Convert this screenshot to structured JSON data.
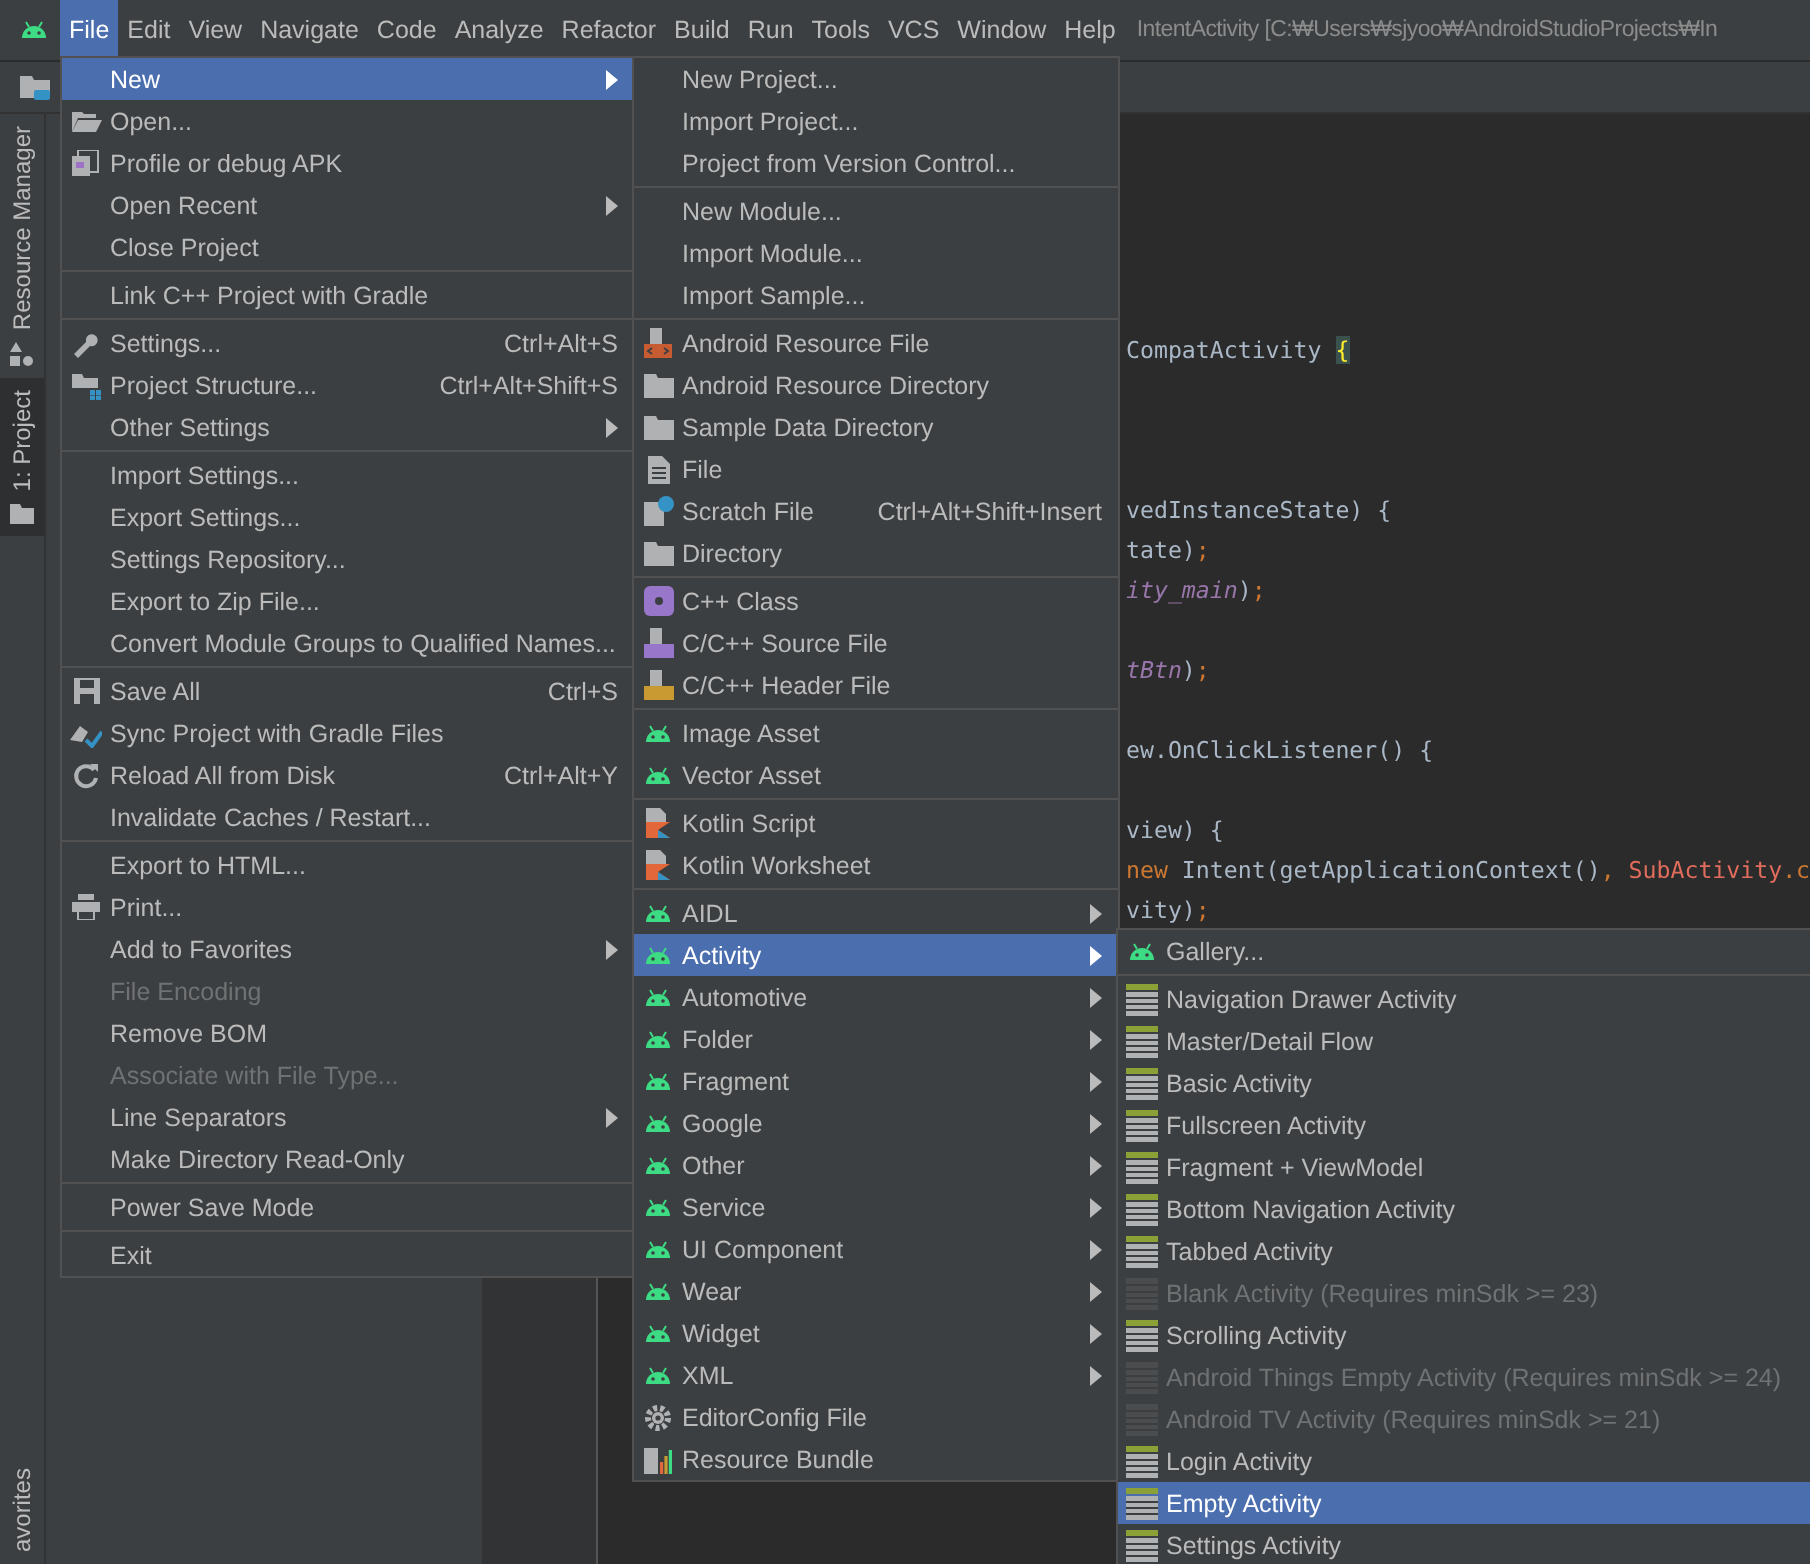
{
  "menu_bar": {
    "items": [
      {
        "label": "File",
        "selected": true
      },
      {
        "label": "Edit",
        "selected": false
      },
      {
        "label": "View",
        "selected": false
      },
      {
        "label": "Navigate",
        "selected": false
      },
      {
        "label": "Code",
        "selected": false
      },
      {
        "label": "Analyze",
        "selected": false
      },
      {
        "label": "Refactor",
        "selected": false
      },
      {
        "label": "Build",
        "selected": false
      },
      {
        "label": "Run",
        "selected": false
      },
      {
        "label": "Tools",
        "selected": false
      },
      {
        "label": "VCS",
        "selected": false
      },
      {
        "label": "Window",
        "selected": false
      },
      {
        "label": "Help",
        "selected": false
      }
    ],
    "title": "IntentActivity [C:₩Users₩sjyoo₩AndroidStudioProjects₩In"
  },
  "side_tabs": [
    {
      "label": "Resource Manager",
      "selected": false
    },
    {
      "label": "1: Project",
      "selected": true
    }
  ],
  "bottom_side_tab": {
    "label": "avorites"
  },
  "editor": {
    "lines": [
      {
        "spans": [
          {
            "text": "CompatActivity ",
            "kind": "plain"
          },
          {
            "text": "{",
            "kind": "brace-match"
          }
        ]
      },
      {
        "kind": "blank"
      },
      {
        "kind": "blank"
      },
      {
        "kind": "blank"
      },
      {
        "spans": [
          {
            "text": "vedInstanceState) {",
            "kind": "plain"
          }
        ]
      },
      {
        "spans": [
          {
            "text": "tate)",
            "kind": "plain"
          },
          {
            "text": ";",
            "kind": "keyword"
          }
        ]
      },
      {
        "spans": [
          {
            "text": "ity_main",
            "kind": "field"
          },
          {
            "text": ")",
            "kind": "plain"
          },
          {
            "text": ";",
            "kind": "keyword"
          }
        ]
      },
      {
        "kind": "blank"
      },
      {
        "spans": [
          {
            "text": "tBtn",
            "kind": "field"
          },
          {
            "text": ")",
            "kind": "plain"
          },
          {
            "text": ";",
            "kind": "keyword"
          }
        ]
      },
      {
        "kind": "blank"
      },
      {
        "spans": [
          {
            "text": "ew.OnClickListener() {",
            "kind": "plain"
          }
        ]
      },
      {
        "kind": "blank"
      },
      {
        "spans": [
          {
            "text": "view) {",
            "kind": "plain"
          }
        ]
      },
      {
        "spans": [
          {
            "text": "new ",
            "kind": "keyword"
          },
          {
            "text": "Intent(getApplicationContext()",
            "kind": "plain"
          },
          {
            "text": ", ",
            "kind": "keyword"
          },
          {
            "text": "SubActivity",
            "kind": "error"
          },
          {
            "text": ".c",
            "kind": "keyword"
          }
        ]
      },
      {
        "spans": [
          {
            "text": "vity)",
            "kind": "plain"
          },
          {
            "text": ";",
            "kind": "keyword"
          }
        ]
      }
    ]
  },
  "file_menu": {
    "groups": [
      {
        "items": [
          {
            "label": "New",
            "selected": true,
            "disabled": false,
            "submenu": true
          },
          {
            "label": "Open...",
            "selected": false,
            "disabled": false
          },
          {
            "label": "Profile or debug APK",
            "selected": false,
            "disabled": false
          },
          {
            "label": "Open Recent",
            "selected": false,
            "disabled": false,
            "submenu": true
          },
          {
            "label": "Close Project",
            "selected": false,
            "disabled": false
          }
        ]
      },
      {
        "items": [
          {
            "label": "Link C++ Project with Gradle",
            "selected": false,
            "disabled": false
          }
        ]
      },
      {
        "items": [
          {
            "label": "Settings...",
            "shortcut": "Ctrl+Alt+S",
            "selected": false,
            "disabled": false
          },
          {
            "label": "Project Structure...",
            "shortcut": "Ctrl+Alt+Shift+S",
            "selected": false,
            "disabled": false
          },
          {
            "label": "Other Settings",
            "selected": false,
            "disabled": false,
            "submenu": true
          }
        ]
      },
      {
        "items": [
          {
            "label": "Import Settings...",
            "selected": false,
            "disabled": false
          },
          {
            "label": "Export Settings...",
            "selected": false,
            "disabled": false
          },
          {
            "label": "Settings Repository...",
            "selected": false,
            "disabled": false
          },
          {
            "label": "Export to Zip File...",
            "selected": false,
            "disabled": false
          },
          {
            "label": "Convert Module Groups to Qualified Names...",
            "selected": false,
            "disabled": false
          }
        ]
      },
      {
        "items": [
          {
            "label": "Save All",
            "shortcut": "Ctrl+S",
            "selected": false,
            "disabled": false
          },
          {
            "label": "Sync Project with Gradle Files",
            "selected": false,
            "disabled": false
          },
          {
            "label": "Reload All from Disk",
            "shortcut": "Ctrl+Alt+Y",
            "selected": false,
            "disabled": false
          },
          {
            "label": "Invalidate Caches / Restart...",
            "selected": false,
            "disabled": false
          }
        ]
      },
      {
        "items": [
          {
            "label": "Export to HTML...",
            "selected": false,
            "disabled": false
          },
          {
            "label": "Print...",
            "selected": false,
            "disabled": false
          },
          {
            "label": "Add to Favorites",
            "selected": false,
            "disabled": false,
            "submenu": true
          },
          {
            "label": "File Encoding",
            "selected": false,
            "disabled": true
          },
          {
            "label": "Remove BOM",
            "selected": false,
            "disabled": false
          },
          {
            "label": "Associate with File Type...",
            "selected": false,
            "disabled": true
          },
          {
            "label": "Line Separators",
            "selected": false,
            "disabled": false,
            "submenu": true
          },
          {
            "label": "Make Directory Read-Only",
            "selected": false,
            "disabled": false
          }
        ]
      },
      {
        "items": [
          {
            "label": "Power Save Mode",
            "selected": false,
            "disabled": false
          }
        ]
      },
      {
        "items": [
          {
            "label": "Exit",
            "selected": false,
            "disabled": false
          }
        ]
      }
    ]
  },
  "new_menu": {
    "groups": [
      {
        "items": [
          {
            "label": "New Project...",
            "selected": false,
            "disabled": false
          },
          {
            "label": "Import Project...",
            "selected": false,
            "disabled": false
          },
          {
            "label": "Project from Version Control...",
            "selected": false,
            "disabled": false
          }
        ]
      },
      {
        "items": [
          {
            "label": "New Module...",
            "selected": false,
            "disabled": false
          },
          {
            "label": "Import Module...",
            "selected": false,
            "disabled": false
          },
          {
            "label": "Import Sample...",
            "selected": false,
            "disabled": false
          }
        ]
      },
      {
        "items": [
          {
            "label": "Android Resource File",
            "selected": false,
            "disabled": false
          },
          {
            "label": "Android Resource Directory",
            "selected": false,
            "disabled": false
          },
          {
            "label": "Sample Data Directory",
            "selected": false,
            "disabled": false
          },
          {
            "label": "File",
            "selected": false,
            "disabled": false
          },
          {
            "label": "Scratch File",
            "shortcut": "Ctrl+Alt+Shift+Insert",
            "selected": false,
            "disabled": false
          },
          {
            "label": "Directory",
            "selected": false,
            "disabled": false
          }
        ]
      },
      {
        "items": [
          {
            "label": "C++ Class",
            "selected": false,
            "disabled": false
          },
          {
            "label": "C/C++ Source File",
            "selected": false,
            "disabled": false
          },
          {
            "label": "C/C++ Header File",
            "selected": false,
            "disabled": false
          }
        ]
      },
      {
        "items": [
          {
            "label": "Image Asset",
            "selected": false,
            "disabled": false
          },
          {
            "label": "Vector Asset",
            "selected": false,
            "disabled": false
          }
        ]
      },
      {
        "items": [
          {
            "label": "Kotlin Script",
            "selected": false,
            "disabled": false
          },
          {
            "label": "Kotlin Worksheet",
            "selected": false,
            "disabled": false
          }
        ]
      },
      {
        "items": [
          {
            "label": "AIDL",
            "selected": false,
            "disabled": false,
            "submenu": true
          },
          {
            "label": "Activity",
            "selected": true,
            "disabled": false,
            "submenu": true
          },
          {
            "label": "Automotive",
            "selected": false,
            "disabled": false,
            "submenu": true
          },
          {
            "label": "Folder",
            "selected": false,
            "disabled": false,
            "submenu": true
          },
          {
            "label": "Fragment",
            "selected": false,
            "disabled": false,
            "submenu": true
          },
          {
            "label": "Google",
            "selected": false,
            "disabled": false,
            "submenu": true
          },
          {
            "label": "Other",
            "selected": false,
            "disabled": false,
            "submenu": true
          },
          {
            "label": "Service",
            "selected": false,
            "disabled": false,
            "submenu": true
          },
          {
            "label": "UI Component",
            "selected": false,
            "disabled": false,
            "submenu": true
          },
          {
            "label": "Wear",
            "selected": false,
            "disabled": false,
            "submenu": true
          },
          {
            "label": "Widget",
            "selected": false,
            "disabled": false,
            "submenu": true
          },
          {
            "label": "XML",
            "selected": false,
            "disabled": false,
            "submenu": true
          },
          {
            "label": "EditorConfig File",
            "selected": false,
            "disabled": false
          },
          {
            "label": "Resource Bundle",
            "selected": false,
            "disabled": false
          }
        ]
      }
    ]
  },
  "activity_menu": {
    "groups": [
      {
        "items": [
          {
            "label": "Gallery...",
            "selected": false,
            "disabled": false
          }
        ]
      },
      {
        "items": [
          {
            "label": "Navigation Drawer Activity",
            "selected": false,
            "disabled": false
          },
          {
            "label": "Master/Detail Flow",
            "selected": false,
            "disabled": false
          },
          {
            "label": "Basic Activity",
            "selected": false,
            "disabled": false
          },
          {
            "label": "Fullscreen Activity",
            "selected": false,
            "disabled": false
          },
          {
            "label": "Fragment + ViewModel",
            "selected": false,
            "disabled": false
          },
          {
            "label": "Bottom Navigation Activity",
            "selected": false,
            "disabled": false
          },
          {
            "label": "Tabbed Activity",
            "selected": false,
            "disabled": false
          },
          {
            "label": "Blank Activity (Requires minSdk >= 23)",
            "selected": false,
            "disabled": true
          },
          {
            "label": "Scrolling Activity",
            "selected": false,
            "disabled": false
          },
          {
            "label": "Android Things Empty Activity (Requires minSdk >= 24)",
            "selected": false,
            "disabled": true
          },
          {
            "label": "Android TV Activity (Requires minSdk >= 21)",
            "selected": false,
            "disabled": true
          },
          {
            "label": "Login Activity",
            "selected": false,
            "disabled": false
          },
          {
            "label": "Empty Activity",
            "selected": true,
            "disabled": false
          },
          {
            "label": "Settings Activity",
            "selected": false,
            "disabled": false
          }
        ]
      }
    ]
  }
}
